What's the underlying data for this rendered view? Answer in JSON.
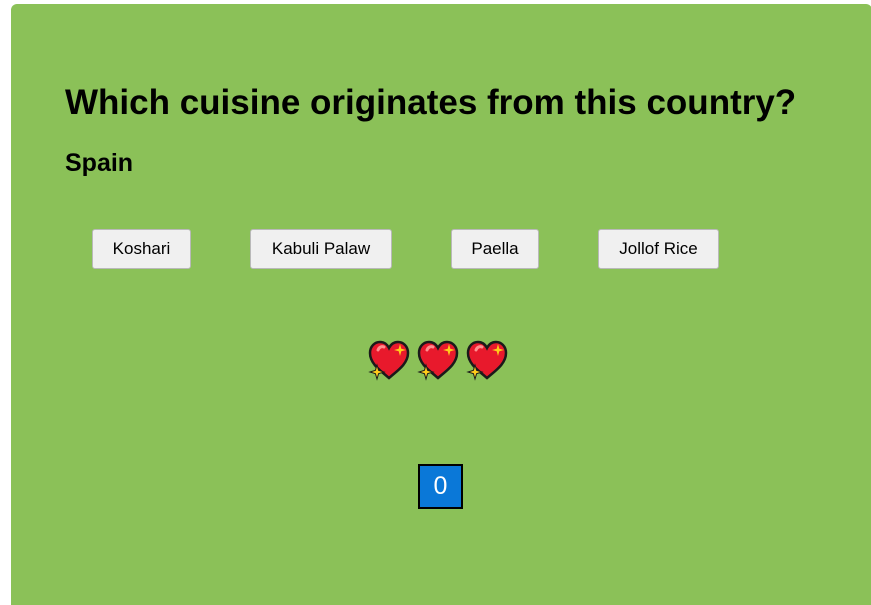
{
  "quiz": {
    "question": "Which cuisine originates from this country?",
    "country": "Spain",
    "options": [
      "Koshari",
      "Kabuli Palaw",
      "Paella",
      "Jollof Rice"
    ]
  },
  "lives": {
    "count": 3,
    "icon": "sparkling-heart-icon"
  },
  "score": {
    "value": "0"
  },
  "colors": {
    "background": "#8bc158",
    "score_box": "#0a78d8",
    "heart": "#e8192c",
    "sparkle": "#ffcc1a"
  }
}
